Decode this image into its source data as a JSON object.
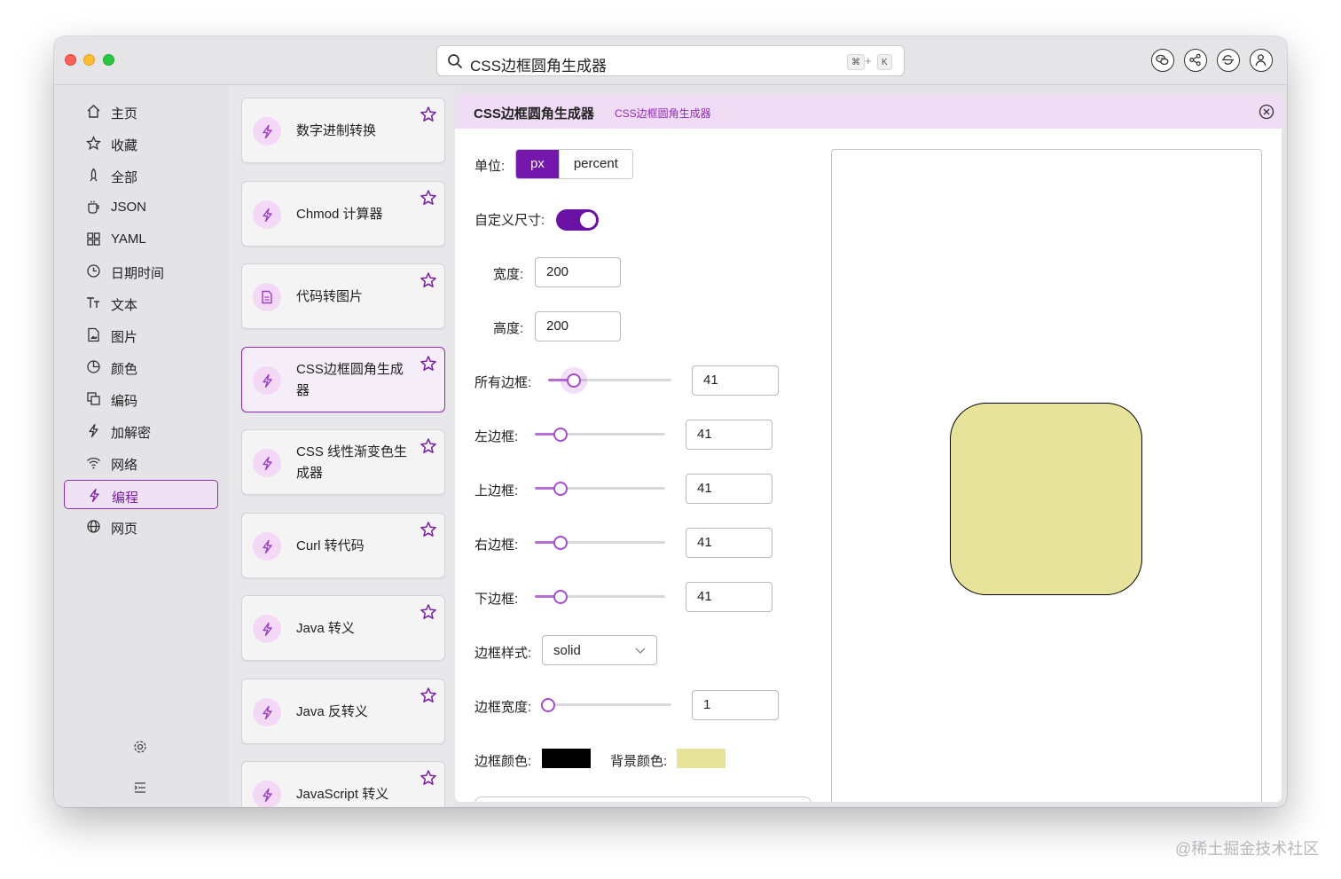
{
  "window": {
    "search_text": "CSS边框圆角生成器",
    "shortcut_cmd": "⌘",
    "shortcut_plus": "+",
    "shortcut_key": "K"
  },
  "toolbar_buttons": [
    {
      "icon": "wechat-icon"
    },
    {
      "icon": "share-icon"
    },
    {
      "icon": "sync-icon"
    },
    {
      "icon": "user-icon"
    }
  ],
  "sidebar": {
    "items": [
      {
        "label": "主页",
        "icon": "home-icon"
      },
      {
        "label": "收藏",
        "icon": "star-icon"
      },
      {
        "label": "全部",
        "icon": "rocket-icon"
      },
      {
        "label": "JSON",
        "icon": "cup-icon"
      },
      {
        "label": "YAML",
        "icon": "grid-icon"
      },
      {
        "label": "日期时间",
        "icon": "clock-icon"
      },
      {
        "label": "文本",
        "icon": "text-icon"
      },
      {
        "label": "图片",
        "icon": "image-icon"
      },
      {
        "label": "颜色",
        "icon": "pie-icon"
      },
      {
        "label": "编码",
        "icon": "copy-icon"
      },
      {
        "label": "加解密",
        "icon": "bolt-icon"
      },
      {
        "label": "网络",
        "icon": "wifi-icon"
      },
      {
        "label": "编程",
        "icon": "bolt-icon"
      },
      {
        "label": "网页",
        "icon": "globe-icon"
      }
    ],
    "active_index": 12
  },
  "tools": [
    {
      "title": "数字进制转换",
      "icon": "bolt-icon"
    },
    {
      "title": "Chmod 计算器",
      "icon": "bolt-icon"
    },
    {
      "title": "代码转图片",
      "icon": "file-icon"
    },
    {
      "title": "CSS边框圆角生成器",
      "icon": "bolt-icon"
    },
    {
      "title": "CSS 线性渐变色生成器",
      "icon": "bolt-icon"
    },
    {
      "title": "Curl 转代码",
      "icon": "bolt-icon"
    },
    {
      "title": "Java 转义",
      "icon": "bolt-icon"
    },
    {
      "title": "Java 反转义",
      "icon": "bolt-icon"
    },
    {
      "title": "JavaScript 转义",
      "icon": "bolt-icon"
    }
  ],
  "content": {
    "title": "CSS边框圆角生成器",
    "subtitle": "CSS边框圆角生成器",
    "unit_label": "单位:",
    "unit_options": [
      "px",
      "percent"
    ],
    "unit_selected": "px",
    "custom_size_label": "自定义尺寸:",
    "custom_size_on": true,
    "width_label": "宽度:",
    "width_value": "200",
    "height_label": "高度:",
    "height_value": "200",
    "all_border_label": "所有边框:",
    "all_border_value": "41",
    "left_border_label": "左边框:",
    "left_border_value": "41",
    "top_border_label": "上边框:",
    "top_border_value": "41",
    "right_border_label": "右边框:",
    "right_border_value": "41",
    "bottom_border_label": "下边框:",
    "bottom_border_value": "41",
    "border_style_label": "边框样式:",
    "border_style_value": "solid",
    "border_width_label": "边框宽度:",
    "border_width_value": "1",
    "border_color_label": "边框颜色:",
    "border_color": "#000000",
    "bg_color_label": "背景颜色:",
    "bg_color": "#e8e39a",
    "accent_color": "#7417ad"
  },
  "watermark": "@稀土掘金技术社区"
}
